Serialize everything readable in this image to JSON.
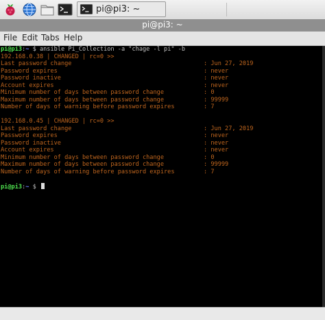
{
  "taskbar": {
    "window_button_label": "pi@pi3: ~"
  },
  "window": {
    "title": "pi@pi3: ~"
  },
  "menu": {
    "file": "File",
    "edit": "Edit",
    "tabs": "Tabs",
    "help": "Help"
  },
  "terminal": {
    "prompt_user": "pi@pi3",
    "prompt_sep": ":",
    "prompt_path": "~",
    "prompt_dollar": " $ ",
    "command": "ansible Pi_Collection -a \"chage -l pi\" -b",
    "hosts": [
      {
        "header": "192.168.0.38 | CHANGED | rc=0 >>",
        "rows": [
          {
            "label": "Last password change",
            "value": "Jun 27, 2019"
          },
          {
            "label": "Password expires",
            "value": "never"
          },
          {
            "label": "Password inactive",
            "value": "never"
          },
          {
            "label": "Account expires",
            "value": "never"
          },
          {
            "label": "Minimum number of days between password change",
            "value": "0"
          },
          {
            "label": "Maximum number of days between password change",
            "value": "99999"
          },
          {
            "label": "Number of days of warning before password expires",
            "value": "7"
          }
        ]
      },
      {
        "header": "192.168.0.45 | CHANGED | rc=0 >>",
        "rows": [
          {
            "label": "Last password change",
            "value": "Jun 27, 2019"
          },
          {
            "label": "Password expires",
            "value": "never"
          },
          {
            "label": "Password inactive",
            "value": "never"
          },
          {
            "label": "Account expires",
            "value": "never"
          },
          {
            "label": "Minimum number of days between password change",
            "value": "0"
          },
          {
            "label": "Maximum number of days between password change",
            "value": "99999"
          },
          {
            "label": "Number of days of warning before password expires",
            "value": "7"
          }
        ]
      }
    ]
  },
  "colors": {
    "prompt": "#4fe34f",
    "path": "#6b7cff",
    "output": "#c0661e",
    "background": "#000000"
  },
  "icons": [
    "raspberry-icon",
    "globe-icon",
    "folder-icon",
    "terminal-icon"
  ]
}
